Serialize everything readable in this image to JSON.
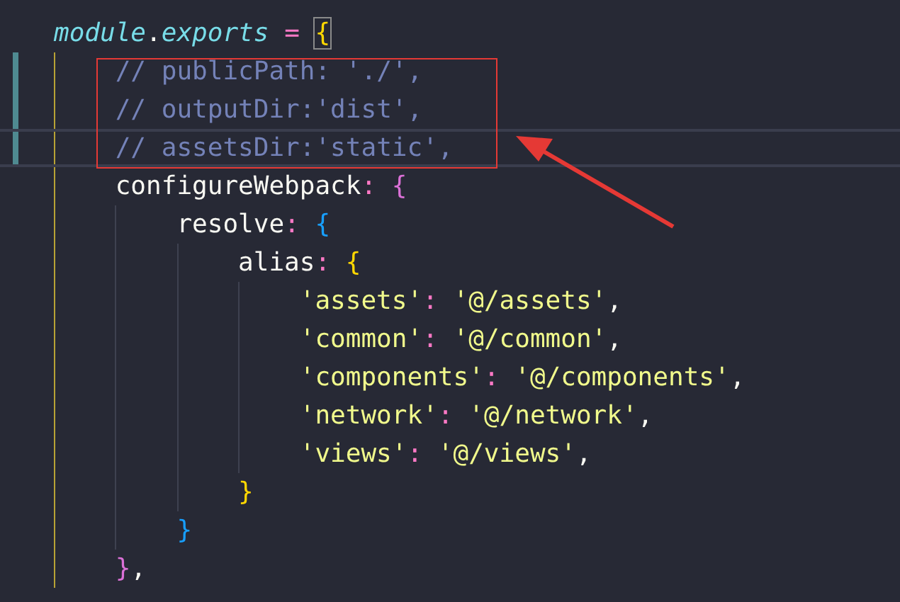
{
  "editor": {
    "lines": [
      {
        "current": false,
        "modified": false,
        "tokens": [
          {
            "kind": "italic",
            "text": "module"
          },
          {
            "kind": "plain",
            "text": "."
          },
          {
            "kind": "italic",
            "text": "exports"
          },
          {
            "kind": "op",
            "text": " = "
          },
          {
            "kind": "brace1",
            "text": "{",
            "matched": true
          }
        ],
        "children": [
          {
            "current": false,
            "modified": true,
            "tokens": [
              {
                "kind": "comment",
                "text": "// publicPath: './',"
              }
            ]
          },
          {
            "current": false,
            "modified": true,
            "tokens": [
              {
                "kind": "comment",
                "text": "// outputDir:'dist',"
              }
            ]
          },
          {
            "current": true,
            "modified": true,
            "tokens": [
              {
                "kind": "comment",
                "text": "// assetsDir:'static',"
              }
            ]
          },
          {
            "current": false,
            "modified": false,
            "tokens": [
              {
                "kind": "plain",
                "text": "configureWebpack"
              },
              {
                "kind": "op",
                "text": ": "
              },
              {
                "kind": "brace2",
                "text": "{"
              }
            ],
            "children": [
              {
                "current": false,
                "modified": false,
                "tokens": [
                  {
                    "kind": "plain",
                    "text": "resolve"
                  },
                  {
                    "kind": "op",
                    "text": ": "
                  },
                  {
                    "kind": "brace3",
                    "text": "{"
                  }
                ],
                "children": [
                  {
                    "current": false,
                    "modified": false,
                    "tokens": [
                      {
                        "kind": "plain",
                        "text": "alias"
                      },
                      {
                        "kind": "op",
                        "text": ": "
                      },
                      {
                        "kind": "brace1",
                        "text": "{"
                      }
                    ],
                    "children": [
                      {
                        "current": false,
                        "modified": false,
                        "tokens": [
                          {
                            "kind": "string",
                            "text": "'assets'"
                          },
                          {
                            "kind": "op",
                            "text": ": "
                          },
                          {
                            "kind": "string",
                            "text": "'@/assets'"
                          },
                          {
                            "kind": "plain",
                            "text": ","
                          }
                        ]
                      },
                      {
                        "current": false,
                        "modified": false,
                        "tokens": [
                          {
                            "kind": "string",
                            "text": "'common'"
                          },
                          {
                            "kind": "op",
                            "text": ": "
                          },
                          {
                            "kind": "string",
                            "text": "'@/common'"
                          },
                          {
                            "kind": "plain",
                            "text": ","
                          }
                        ]
                      },
                      {
                        "current": false,
                        "modified": false,
                        "tokens": [
                          {
                            "kind": "string",
                            "text": "'components'"
                          },
                          {
                            "kind": "op",
                            "text": ": "
                          },
                          {
                            "kind": "string",
                            "text": "'@/components'"
                          },
                          {
                            "kind": "plain",
                            "text": ","
                          }
                        ]
                      },
                      {
                        "current": false,
                        "modified": false,
                        "tokens": [
                          {
                            "kind": "string",
                            "text": "'network'"
                          },
                          {
                            "kind": "op",
                            "text": ": "
                          },
                          {
                            "kind": "string",
                            "text": "'@/network'"
                          },
                          {
                            "kind": "plain",
                            "text": ","
                          }
                        ]
                      },
                      {
                        "current": false,
                        "modified": false,
                        "tokens": [
                          {
                            "kind": "string",
                            "text": "'views'"
                          },
                          {
                            "kind": "op",
                            "text": ": "
                          },
                          {
                            "kind": "string",
                            "text": "'@/views'"
                          },
                          {
                            "kind": "plain",
                            "text": ","
                          }
                        ]
                      }
                    ]
                  },
                  {
                    "current": false,
                    "modified": false,
                    "tokens": [
                      {
                        "kind": "brace1",
                        "text": "}"
                      }
                    ]
                  }
                ]
              },
              {
                "current": false,
                "modified": false,
                "tokens": [
                  {
                    "kind": "brace3",
                    "text": "}"
                  }
                ]
              }
            ]
          },
          {
            "current": false,
            "modified": false,
            "tokens": [
              {
                "kind": "brace2",
                "text": "}"
              },
              {
                "kind": "plain",
                "text": ","
              }
            ]
          }
        ]
      }
    ]
  }
}
